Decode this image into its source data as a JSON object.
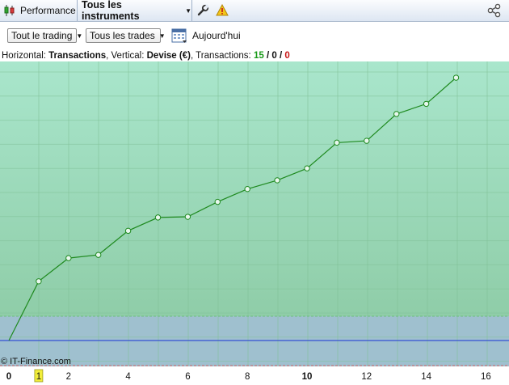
{
  "tabs": {
    "performance_label": "Performance",
    "instruments_label": "Tous les instruments"
  },
  "toolbar": {
    "trading_select": "Tout le trading",
    "trades_select": "Tous les trades",
    "date_label": "Aujourd'hui"
  },
  "info": {
    "horizontal_prefix": "Horizontal: ",
    "horizontal_value": "Transactions",
    "vertical_prefix": ", Vertical: ",
    "vertical_value": "Devise (€)",
    "transactions_prefix": ", Transactions: ",
    "wins": "15",
    "neutral": "0",
    "losses": "0",
    "sep": " / "
  },
  "copyright": "© IT-Finance.com",
  "colors": {
    "profit_area": "#a6e3c8",
    "loss_area": "#9fc0cf",
    "line": "#1f8a1f",
    "zero_line": "#1a33d6"
  },
  "chart_data": {
    "type": "line",
    "x_ticks": [
      "0",
      "1",
      "2",
      "4",
      "6",
      "8",
      "10",
      "12",
      "14",
      "16"
    ],
    "highlight_tick": "1",
    "xlim": [
      0,
      16.5
    ],
    "series": [
      {
        "x": [
          0,
          1,
          2,
          3,
          4,
          5,
          6,
          7,
          8,
          9,
          10,
          11,
          12,
          13,
          14,
          15
        ],
        "y": [
          0,
          258,
          359,
          373,
          478,
          536,
          539,
          604,
          660,
          698,
          750,
          862,
          870,
          987,
          1031,
          1145
        ]
      }
    ]
  }
}
